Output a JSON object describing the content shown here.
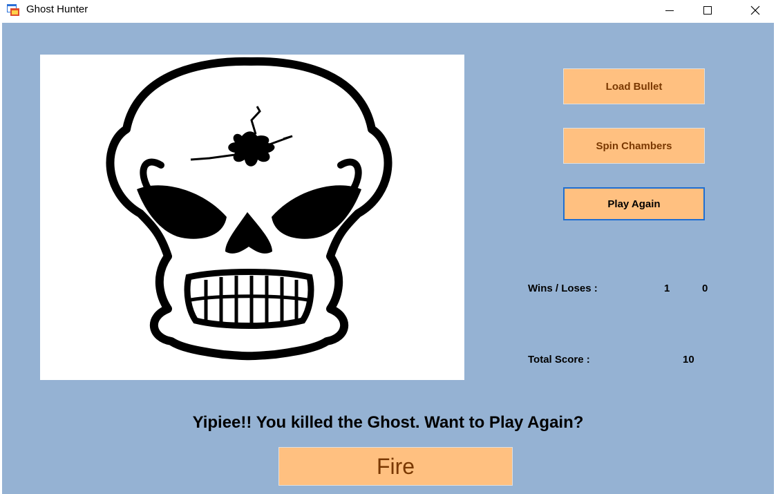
{
  "window": {
    "title": "Ghost Hunter",
    "icons": {
      "app": "form-app-icon",
      "minimize": "minimize-icon",
      "maximize": "maximize-icon",
      "close": "close-icon"
    }
  },
  "main": {
    "image": "skull-with-bullet-hole",
    "buttons": {
      "load_bullet": "Load Bullet",
      "spin_chambers": "Spin Chambers",
      "play_again": "Play Again",
      "fire": "Fire"
    },
    "stats": {
      "wins_loses_label": "Wins / Loses :",
      "wins": "1",
      "loses": "0",
      "total_score_label": "Total Score :",
      "total_score": "10"
    },
    "message": "Yipiee!! You killed the Ghost. Want to Play Again?"
  },
  "colors": {
    "client_background": "#95b2d3",
    "button_background": "#ffc080",
    "button_text": "#7a3800",
    "focus_border": "#1f6ed1"
  }
}
